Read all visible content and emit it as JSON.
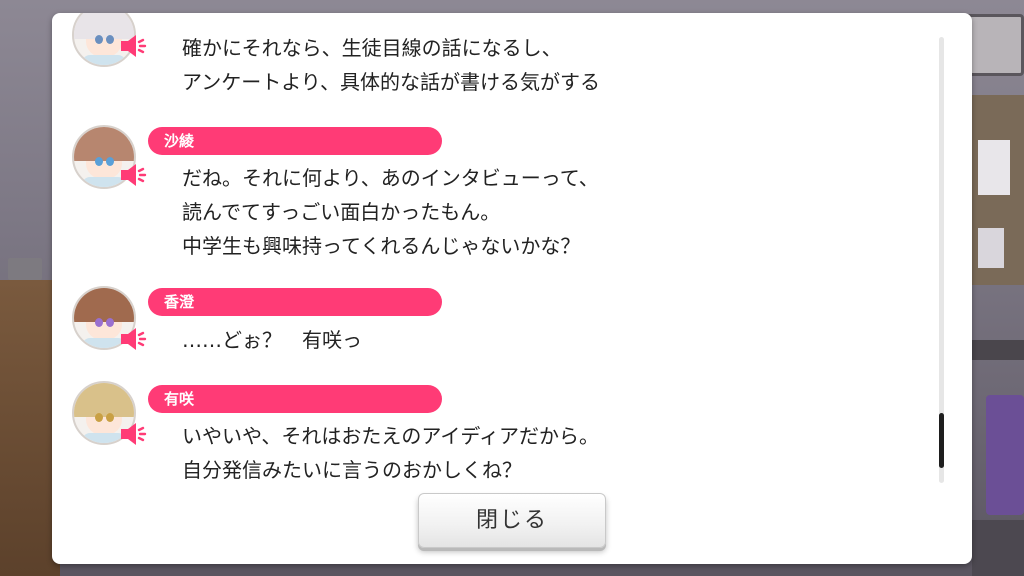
{
  "colors": {
    "nameplate": "#ff3b76",
    "speaker_icon": "#ff3b76",
    "text": "#222222",
    "panel": "#ffffff"
  },
  "messages": [
    {
      "speaker": "",
      "avatar_hair": "#e8e4e8",
      "eye_color": "#6a8fbf",
      "lines": [
        "確かにそれなら、生徒目線の話になるし、",
        "アンケートより、具体的な話が書ける気がする"
      ]
    },
    {
      "speaker": "沙綾",
      "avatar_hair": "#b7866f",
      "eye_color": "#5aa0d8",
      "lines": [
        "だね。それに何より、あのインタビューって、",
        "読んでてすっごい面白かったもん。",
        "中学生も興味持ってくれるんじゃないかな？"
      ]
    },
    {
      "speaker": "香澄",
      "avatar_hair": "#a06a4e",
      "eye_color": "#9a70d0",
      "lines": [
        "……どぉ？　有咲っ"
      ]
    },
    {
      "speaker": "有咲",
      "avatar_hair": "#d9c18a",
      "eye_color": "#c9a044",
      "lines": [
        "いやいや、それはおたえのアイディアだから。",
        "自分発信みたいに言うのおかしくね？"
      ]
    }
  ],
  "speaker_icon": "speaker-icon",
  "close_button": {
    "label": "閉じる"
  }
}
